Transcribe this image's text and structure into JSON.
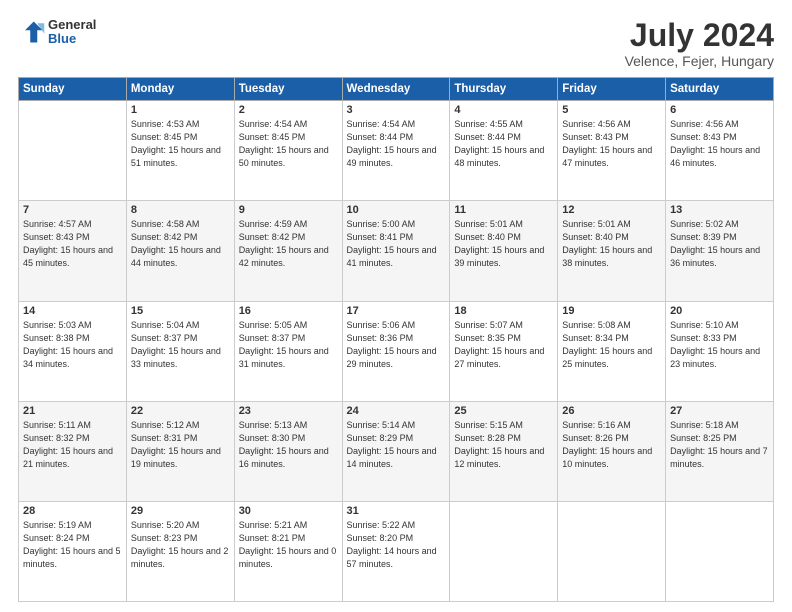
{
  "logo": {
    "general": "General",
    "blue": "Blue"
  },
  "header": {
    "month_year": "July 2024",
    "location": "Velence, Fejer, Hungary"
  },
  "weekdays": [
    "Sunday",
    "Monday",
    "Tuesday",
    "Wednesday",
    "Thursday",
    "Friday",
    "Saturday"
  ],
  "weeks": [
    [
      {
        "day": "",
        "content": ""
      },
      {
        "day": "1",
        "content": "Sunrise: 4:53 AM\nSunset: 8:45 PM\nDaylight: 15 hours\nand 51 minutes."
      },
      {
        "day": "2",
        "content": "Sunrise: 4:54 AM\nSunset: 8:45 PM\nDaylight: 15 hours\nand 50 minutes."
      },
      {
        "day": "3",
        "content": "Sunrise: 4:54 AM\nSunset: 8:44 PM\nDaylight: 15 hours\nand 49 minutes."
      },
      {
        "day": "4",
        "content": "Sunrise: 4:55 AM\nSunset: 8:44 PM\nDaylight: 15 hours\nand 48 minutes."
      },
      {
        "day": "5",
        "content": "Sunrise: 4:56 AM\nSunset: 8:43 PM\nDaylight: 15 hours\nand 47 minutes."
      },
      {
        "day": "6",
        "content": "Sunrise: 4:56 AM\nSunset: 8:43 PM\nDaylight: 15 hours\nand 46 minutes."
      }
    ],
    [
      {
        "day": "7",
        "content": "Sunrise: 4:57 AM\nSunset: 8:43 PM\nDaylight: 15 hours\nand 45 minutes."
      },
      {
        "day": "8",
        "content": "Sunrise: 4:58 AM\nSunset: 8:42 PM\nDaylight: 15 hours\nand 44 minutes."
      },
      {
        "day": "9",
        "content": "Sunrise: 4:59 AM\nSunset: 8:42 PM\nDaylight: 15 hours\nand 42 minutes."
      },
      {
        "day": "10",
        "content": "Sunrise: 5:00 AM\nSunset: 8:41 PM\nDaylight: 15 hours\nand 41 minutes."
      },
      {
        "day": "11",
        "content": "Sunrise: 5:01 AM\nSunset: 8:40 PM\nDaylight: 15 hours\nand 39 minutes."
      },
      {
        "day": "12",
        "content": "Sunrise: 5:01 AM\nSunset: 8:40 PM\nDaylight: 15 hours\nand 38 minutes."
      },
      {
        "day": "13",
        "content": "Sunrise: 5:02 AM\nSunset: 8:39 PM\nDaylight: 15 hours\nand 36 minutes."
      }
    ],
    [
      {
        "day": "14",
        "content": "Sunrise: 5:03 AM\nSunset: 8:38 PM\nDaylight: 15 hours\nand 34 minutes."
      },
      {
        "day": "15",
        "content": "Sunrise: 5:04 AM\nSunset: 8:37 PM\nDaylight: 15 hours\nand 33 minutes."
      },
      {
        "day": "16",
        "content": "Sunrise: 5:05 AM\nSunset: 8:37 PM\nDaylight: 15 hours\nand 31 minutes."
      },
      {
        "day": "17",
        "content": "Sunrise: 5:06 AM\nSunset: 8:36 PM\nDaylight: 15 hours\nand 29 minutes."
      },
      {
        "day": "18",
        "content": "Sunrise: 5:07 AM\nSunset: 8:35 PM\nDaylight: 15 hours\nand 27 minutes."
      },
      {
        "day": "19",
        "content": "Sunrise: 5:08 AM\nSunset: 8:34 PM\nDaylight: 15 hours\nand 25 minutes."
      },
      {
        "day": "20",
        "content": "Sunrise: 5:10 AM\nSunset: 8:33 PM\nDaylight: 15 hours\nand 23 minutes."
      }
    ],
    [
      {
        "day": "21",
        "content": "Sunrise: 5:11 AM\nSunset: 8:32 PM\nDaylight: 15 hours\nand 21 minutes."
      },
      {
        "day": "22",
        "content": "Sunrise: 5:12 AM\nSunset: 8:31 PM\nDaylight: 15 hours\nand 19 minutes."
      },
      {
        "day": "23",
        "content": "Sunrise: 5:13 AM\nSunset: 8:30 PM\nDaylight: 15 hours\nand 16 minutes."
      },
      {
        "day": "24",
        "content": "Sunrise: 5:14 AM\nSunset: 8:29 PM\nDaylight: 15 hours\nand 14 minutes."
      },
      {
        "day": "25",
        "content": "Sunrise: 5:15 AM\nSunset: 8:28 PM\nDaylight: 15 hours\nand 12 minutes."
      },
      {
        "day": "26",
        "content": "Sunrise: 5:16 AM\nSunset: 8:26 PM\nDaylight: 15 hours\nand 10 minutes."
      },
      {
        "day": "27",
        "content": "Sunrise: 5:18 AM\nSunset: 8:25 PM\nDaylight: 15 hours\nand 7 minutes."
      }
    ],
    [
      {
        "day": "28",
        "content": "Sunrise: 5:19 AM\nSunset: 8:24 PM\nDaylight: 15 hours\nand 5 minutes."
      },
      {
        "day": "29",
        "content": "Sunrise: 5:20 AM\nSunset: 8:23 PM\nDaylight: 15 hours\nand 2 minutes."
      },
      {
        "day": "30",
        "content": "Sunrise: 5:21 AM\nSunset: 8:21 PM\nDaylight: 15 hours\nand 0 minutes."
      },
      {
        "day": "31",
        "content": "Sunrise: 5:22 AM\nSunset: 8:20 PM\nDaylight: 14 hours\nand 57 minutes."
      },
      {
        "day": "",
        "content": ""
      },
      {
        "day": "",
        "content": ""
      },
      {
        "day": "",
        "content": ""
      }
    ]
  ]
}
